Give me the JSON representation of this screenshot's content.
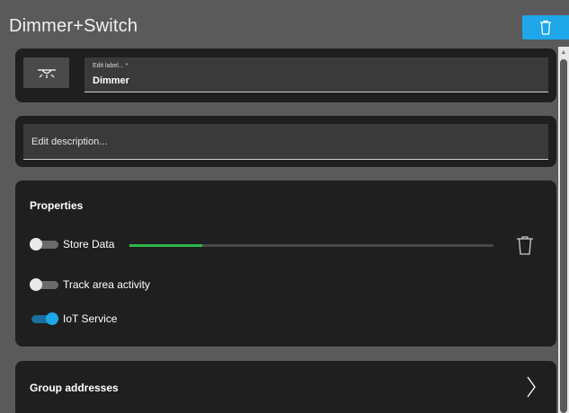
{
  "header": {
    "title": "Dimmer+Switch",
    "delete_icon": "trash-icon",
    "accent_color": "#1ea7e9"
  },
  "label_card": {
    "light_icon": "ceiling-light-icon",
    "field_small_label": "Edit label... *",
    "field_value": "Dimmer"
  },
  "description_card": {
    "placeholder": "Edit description..."
  },
  "properties": {
    "title": "Properties",
    "items": [
      {
        "label": "Store Data",
        "enabled": false,
        "progress": 0.2,
        "progress_color": "#2eb84b",
        "trash_icon": "trash-icon"
      },
      {
        "label": "Track area activity",
        "enabled": false
      },
      {
        "label": "IoT Service",
        "enabled": true
      }
    ]
  },
  "group_addresses": {
    "title": "Group addresses",
    "icon": "chevron-right-icon"
  }
}
